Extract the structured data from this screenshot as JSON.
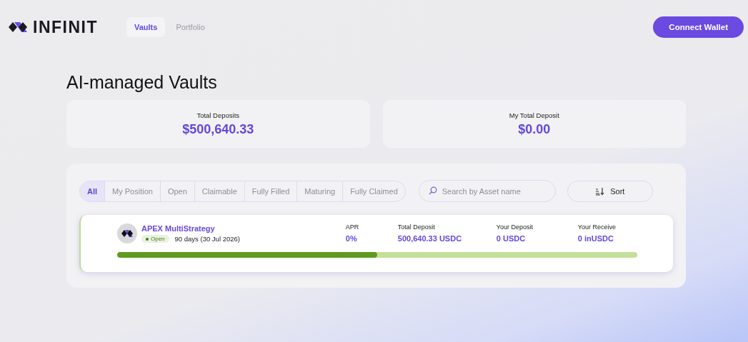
{
  "brand": {
    "name": "INFINIT"
  },
  "nav": [
    {
      "label": "Vaults",
      "selected": true
    },
    {
      "label": "Portfolio",
      "selected": false
    }
  ],
  "connect_button": "Connect Wallet",
  "page_title": "AI-managed Vaults",
  "stats": [
    {
      "label": "Total Deposits",
      "value": "$500,640.33"
    },
    {
      "label": "My Total Deposit",
      "value": "$0.00"
    }
  ],
  "filters": [
    {
      "label": "All",
      "selected": true
    },
    {
      "label": "My Position",
      "selected": false
    },
    {
      "label": "Open",
      "selected": false
    },
    {
      "label": "Claimable",
      "selected": false
    },
    {
      "label": "Fully Filled",
      "selected": false
    },
    {
      "label": "Maturing",
      "selected": false
    },
    {
      "label": "Fully Claimed",
      "selected": false
    }
  ],
  "search": {
    "placeholder": "Search by Asset name"
  },
  "sort_button": "Sort",
  "vaults": [
    {
      "name": "APEX MultiStrategy",
      "status": "Open",
      "term": "90 days (30 Jul 2026)",
      "level": 0.5,
      "metrics": [
        {
          "label": "APR",
          "value": "0%"
        },
        {
          "label": "Total Deposit",
          "value": "500,640.33 USDC"
        },
        {
          "label": "Your Deposit",
          "value": "0 USDC"
        },
        {
          "label": "Your Receive",
          "value": "0 inUSDC"
        }
      ]
    }
  ]
}
